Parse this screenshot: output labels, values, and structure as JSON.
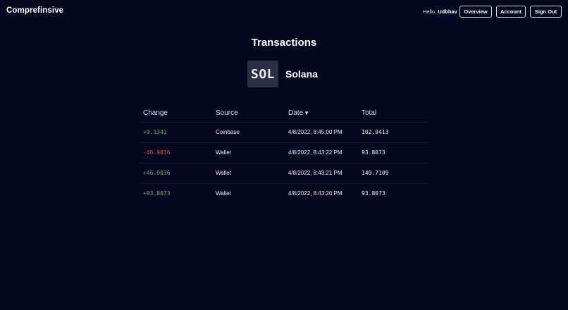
{
  "app": {
    "title": "Comprefinsive"
  },
  "header": {
    "greeting_prefix": "Hello, ",
    "username": "Udbhav",
    "nav": {
      "overview": "Overview",
      "account": "Account",
      "signout": "Sign Out"
    }
  },
  "page": {
    "title": "Transactions",
    "coin": {
      "symbol": "SOL",
      "name": "Solana"
    }
  },
  "table": {
    "columns": {
      "change": "Change",
      "source": "Source",
      "date": "Date",
      "total": "Total"
    },
    "sort": {
      "column": "date",
      "direction": "descending",
      "indicator": "▼"
    },
    "rows": [
      {
        "change": "+9.1341",
        "direction": "positive",
        "source": "Coinbase",
        "date": "4/8/2022, 8:45:00 PM",
        "total": "102.9413"
      },
      {
        "change": "-46.9036",
        "direction": "negative",
        "source": "Wallet",
        "date": "4/8/2022, 8:43:22 PM",
        "total": "93.8073"
      },
      {
        "change": "+46.9036",
        "direction": "positive",
        "source": "Wallet",
        "date": "4/8/2022, 8:43:21 PM",
        "total": "140.7109"
      },
      {
        "change": "+93.8073",
        "direction": "positive",
        "source": "Wallet",
        "date": "4/8/2022, 8:43:20 PM",
        "total": "93.8073"
      }
    ]
  },
  "colors": {
    "background": "#050720",
    "positive": "#5fb86a",
    "negative": "#e0564b",
    "logo_bg": "#2b2e45"
  }
}
